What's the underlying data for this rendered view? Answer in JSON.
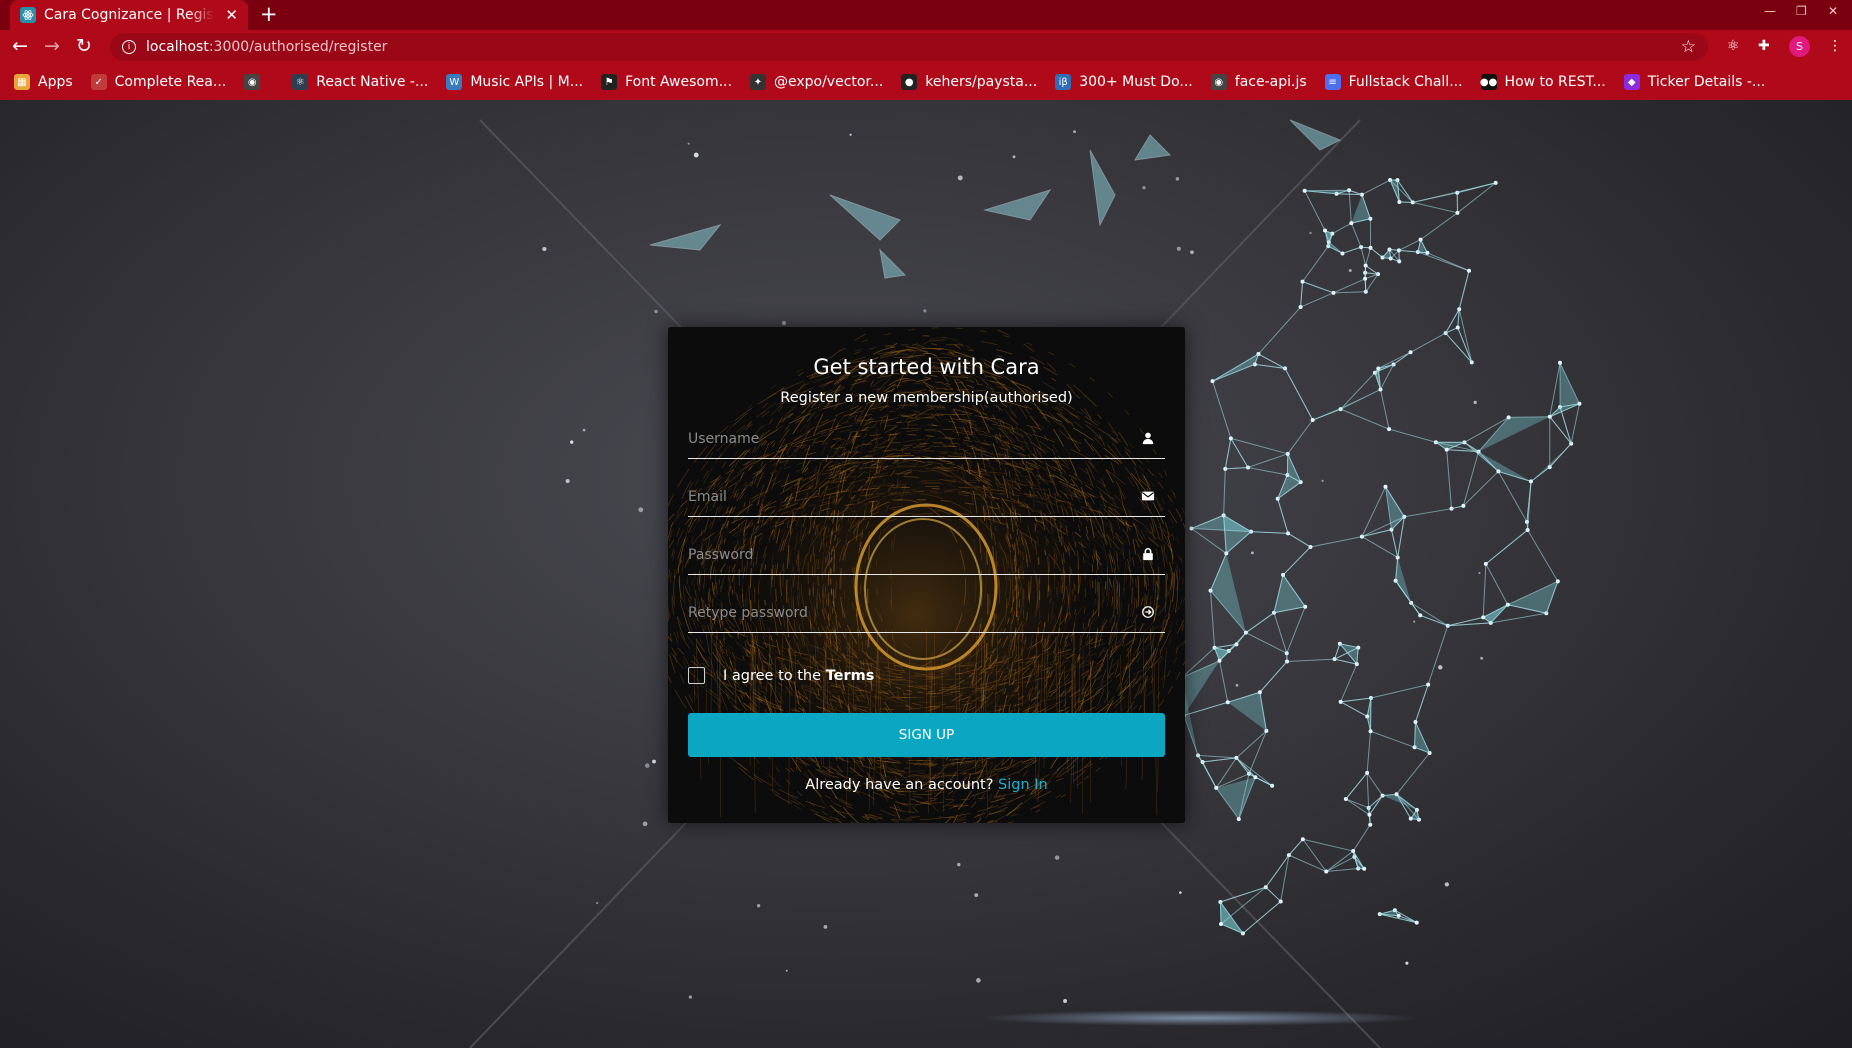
{
  "browser": {
    "tab_title": "Cara Cognizance | Register",
    "new_tab_symbol": "+",
    "url_host": "localhost",
    "url_rest": ":3000/authorised/register",
    "profile_initial": "S",
    "bookmarks": [
      {
        "label": "Apps",
        "icon": "apps-grid-icon",
        "color": "#e8a53b"
      },
      {
        "label": "Complete Rea...",
        "icon": "react-icon",
        "color": "#c23b3b"
      },
      {
        "label": "",
        "icon": "globe-icon",
        "color": "#444"
      },
      {
        "label": "React Native -...",
        "icon": "react-native-icon",
        "color": "#2d3e50"
      },
      {
        "label": "Music APIs | M...",
        "icon": "wordpress-icon",
        "color": "#3a7bbf"
      },
      {
        "label": "Font Awesom...",
        "icon": "flag-icon",
        "color": "#222"
      },
      {
        "label": "@expo/vector...",
        "icon": "expo-icon",
        "color": "#333"
      },
      {
        "label": "kehers/paysta...",
        "icon": "github-icon",
        "color": "#222"
      },
      {
        "label": "300+ Must Do...",
        "icon": "ib-icon",
        "color": "#2f6db5"
      },
      {
        "label": "face-api.js",
        "icon": "globe-icon",
        "color": "#444"
      },
      {
        "label": "Fullstack Chall...",
        "icon": "doc-icon",
        "color": "#4c6ff0"
      },
      {
        "label": "How to REST...",
        "icon": "medium-icon",
        "color": "#111"
      },
      {
        "label": "Ticker Details -...",
        "icon": "ticker-icon",
        "color": "#8a2be2"
      }
    ]
  },
  "register": {
    "title": "Get started with Cara",
    "subtitle": "Register a new membership(authorised)",
    "fields": {
      "username": {
        "placeholder": "Username",
        "value": ""
      },
      "email": {
        "placeholder": "Email",
        "value": ""
      },
      "password": {
        "placeholder": "Password",
        "value": ""
      },
      "retype": {
        "placeholder": "Retype password",
        "value": ""
      }
    },
    "terms_prefix": "I agree to the ",
    "terms_link": "Terms",
    "terms_checked": false,
    "signup_label": "SIGN UP",
    "signin_prompt": "Already have an account? ",
    "signin_link": "Sign In"
  },
  "colors": {
    "chrome": "#b00a1a",
    "accent": "#0aa6c2",
    "link": "#17b3d4"
  }
}
